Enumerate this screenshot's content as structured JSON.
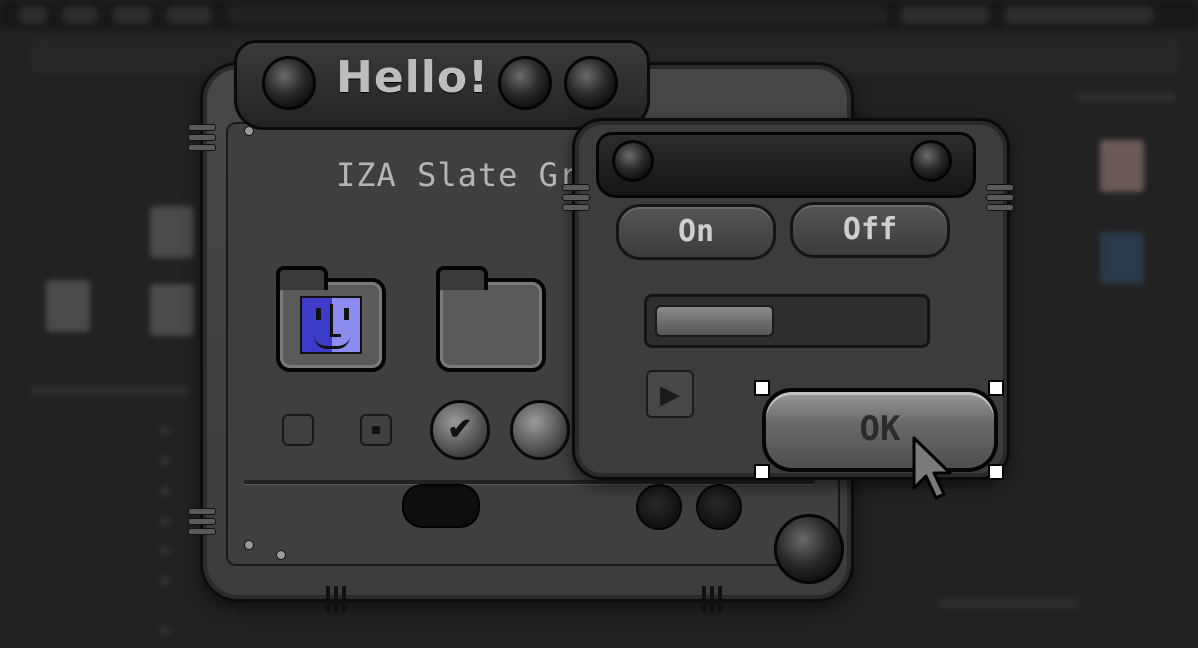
{
  "colors": {
    "slate": "#474747",
    "slate_dark": "#1a1a1a",
    "finder_light": "#8b8bf0",
    "finder_dark": "#3c3cc8",
    "text": "#bdbdbd"
  },
  "main_window": {
    "title": "Hello!",
    "subtitle": "IZA Slate Gr",
    "icons": [
      "finder-icon",
      "folder-icon"
    ],
    "controls": [
      "checkbox-empty",
      "checkbox-checked",
      "checkmark-radio",
      "radio"
    ]
  },
  "dialog": {
    "on_label": "On",
    "off_label": "Off",
    "progress_fraction": 0.45,
    "ok_label": "OK"
  }
}
